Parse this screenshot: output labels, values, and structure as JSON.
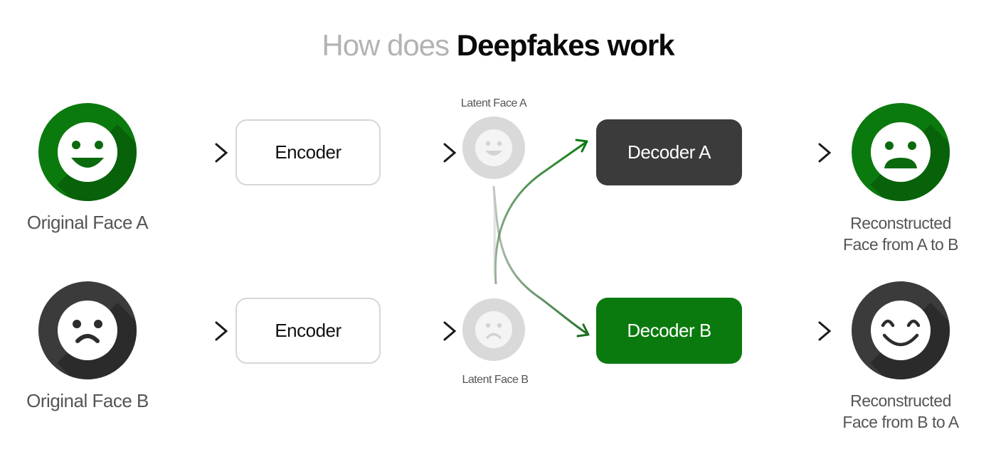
{
  "title": {
    "light": "How does",
    "bold": "Deepfakes work"
  },
  "colors": {
    "green": "#0b7a0e",
    "dark": "#3b3b3b",
    "latent": "#d9d9d9",
    "arrow": "#1a1a1a"
  },
  "row_a": {
    "input_label": "Original Face A",
    "input_icon": "smile-open-icon",
    "encoder_label": "Encoder",
    "latent_label": "Latent Face A",
    "decoder_label": "Decoder A",
    "output_label_line1": "Reconstructed",
    "output_label_line2": "Face from A to B",
    "output_icon": "frown-open-icon"
  },
  "row_b": {
    "input_label": "Original Face B",
    "input_icon": "frown-icon",
    "encoder_label": "Encoder",
    "latent_label": "Latent Face B",
    "decoder_label": "Decoder B",
    "output_label_line1": "Reconstructed",
    "output_label_line2": "Face from B to A",
    "output_icon": "smile-eyes-closed-icon"
  },
  "edges": [
    {
      "from": "Original Face A",
      "to": "Encoder A"
    },
    {
      "from": "Encoder A",
      "to": "Latent Face A"
    },
    {
      "from": "Latent Face A",
      "to": "Decoder B",
      "style": "swap"
    },
    {
      "from": "Latent Face B",
      "to": "Decoder A",
      "style": "swap"
    },
    {
      "from": "Decoder A",
      "to": "Reconstructed Face from A to B"
    },
    {
      "from": "Original Face B",
      "to": "Encoder B"
    },
    {
      "from": "Encoder B",
      "to": "Latent Face B"
    },
    {
      "from": "Decoder B",
      "to": "Reconstructed Face from B to A"
    }
  ]
}
